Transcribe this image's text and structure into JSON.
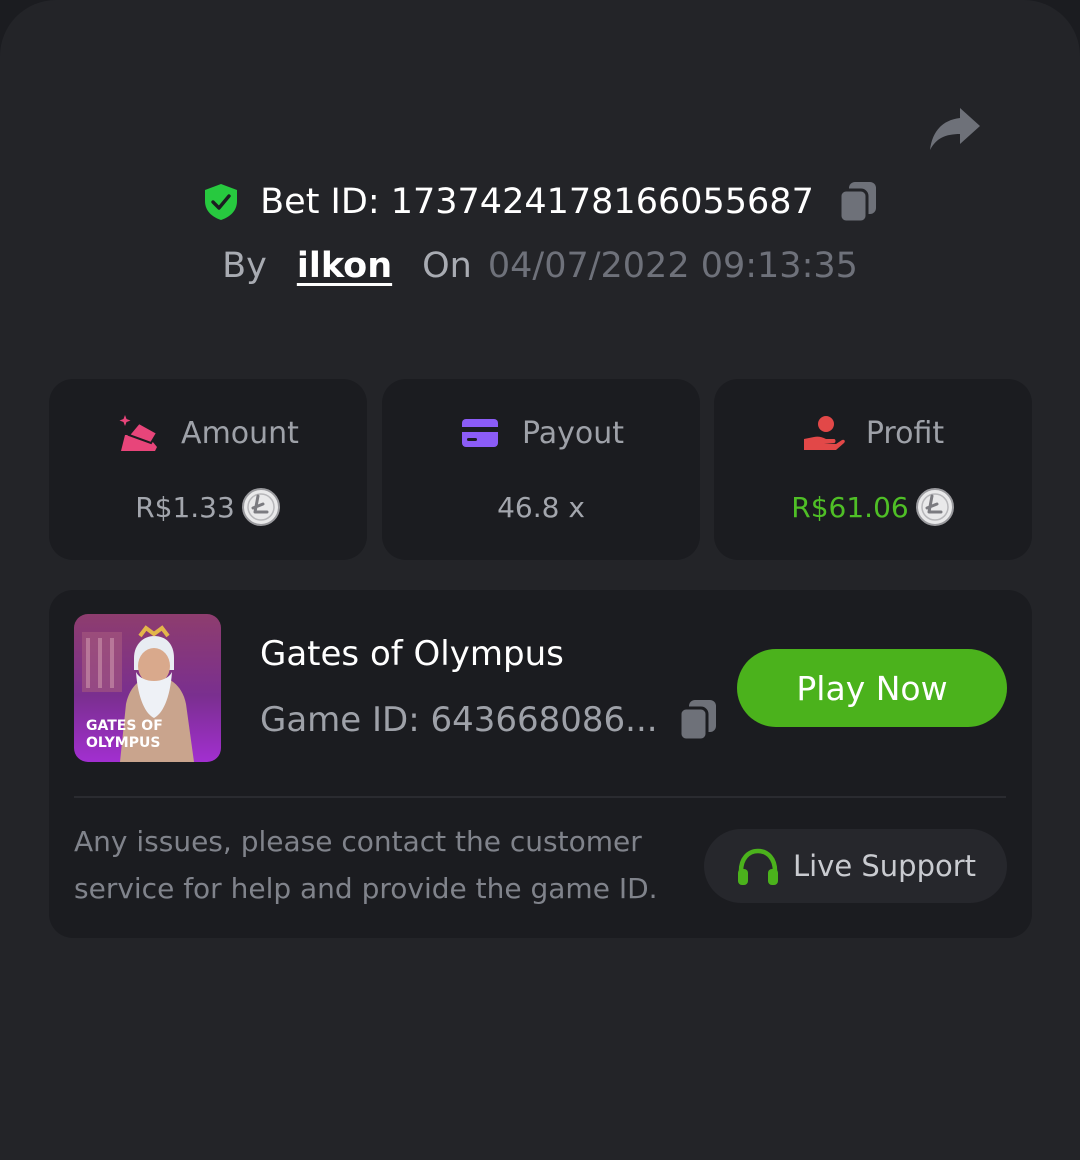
{
  "header": {
    "bet_id_text": "Bet ID: 1737424178166055687",
    "by_label": "By",
    "username": "ilkon",
    "on_label": "On",
    "date": "04/07/2022 09:13:35"
  },
  "stats": [
    {
      "label": "Amount",
      "value": "R$1.33",
      "icon": "amount-icon"
    },
    {
      "label": "Payout",
      "value": "46.8 x",
      "icon": "card-icon"
    },
    {
      "label": "Profit",
      "value": "R$61.06",
      "icon": "hand-money-icon"
    }
  ],
  "game": {
    "title": "Gates of Olympus",
    "game_id_text": "Game ID: 643668086...",
    "thumb_line1": "GATES OF",
    "thumb_line2": "OLYMPUS",
    "play_label": "Play Now"
  },
  "support": {
    "notice": "Any issues, please contact the customer service for help and provide the game ID.",
    "button_label": "Live Support"
  },
  "colors": {
    "accent_green": "#4bb21c",
    "profit_green": "#4fbf26",
    "verified_green": "#27c93f",
    "payout_purple": "#8b5cf6",
    "amount_pink": "#e8457a",
    "profit_red": "#e24848"
  }
}
